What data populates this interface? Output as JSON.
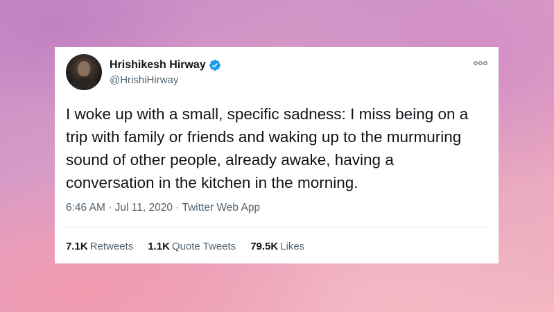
{
  "tweet": {
    "author_name": "Hrishikesh Hirway",
    "handle": "@HrishiHirway",
    "verified": true,
    "text": "I woke up with a small, specific sadness: I miss being on a\ntrip with family or friends and waking up to the murmuring\nsound of other people, already awake, having a\nconversation in the kitchen in the morning.",
    "time": "6:46 AM",
    "date": "Jul 11, 2020",
    "source": "Twitter Web App",
    "separator": "·",
    "stats": {
      "retweets_count": "7.1K",
      "retweets_label": "Retweets",
      "quotes_count": "1.1K",
      "quotes_label": "Quote Tweets",
      "likes_count": "79.5K",
      "likes_label": "Likes"
    }
  },
  "icons": {
    "avatar": "profile-photo",
    "verified": "verified-badge-icon",
    "more": "more-options-icon"
  },
  "colors": {
    "verified_blue": "#1d9bf0",
    "secondary_text": "#536471",
    "primary_text": "#0f1419"
  }
}
